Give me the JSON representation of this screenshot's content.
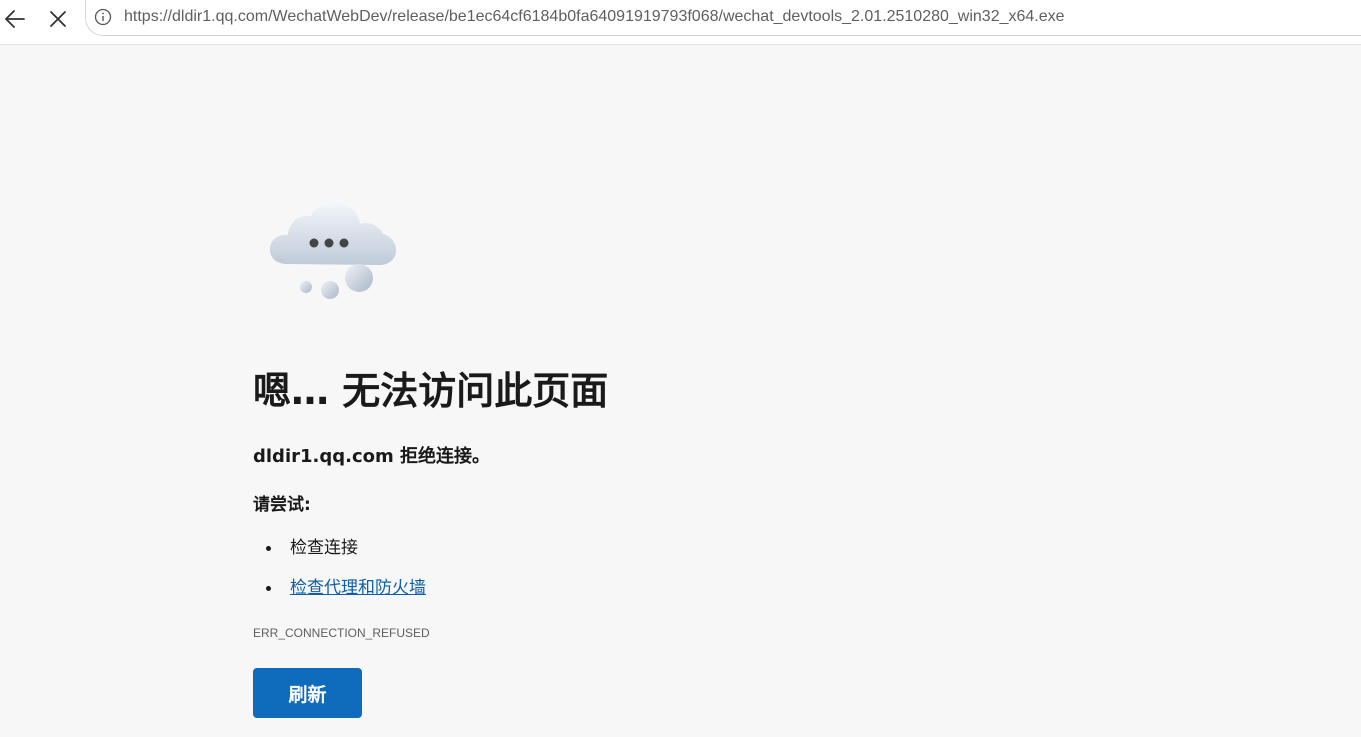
{
  "browser": {
    "back_icon": "arrow-left-icon",
    "stop_icon": "close-icon",
    "info_icon": "info-circle-icon",
    "url": "https://dldir1.qq.com/WechatWebDev/release/be1ec64cf6184b0fa64091919793f068/wechat_devtools_2.01.2510280_win32_x64.exe"
  },
  "error_page": {
    "illustration_icon": "cloud-ellipsis-icon",
    "heading": "嗯… 无法访问此页面",
    "subheading": "dldir1.qq.com 拒绝连接。",
    "try_label": "请尝试:",
    "suggestions": [
      {
        "label": "检查连接",
        "is_link": false
      },
      {
        "label": "检查代理和防火墙",
        "is_link": true
      }
    ],
    "error_code": "ERR_CONNECTION_REFUSED",
    "refresh_label": "刷新"
  },
  "colors": {
    "page_background": "#f7f7f7",
    "link": "#0e5eaa",
    "button": "#0f6cbd",
    "button_text": "#ffffff"
  }
}
